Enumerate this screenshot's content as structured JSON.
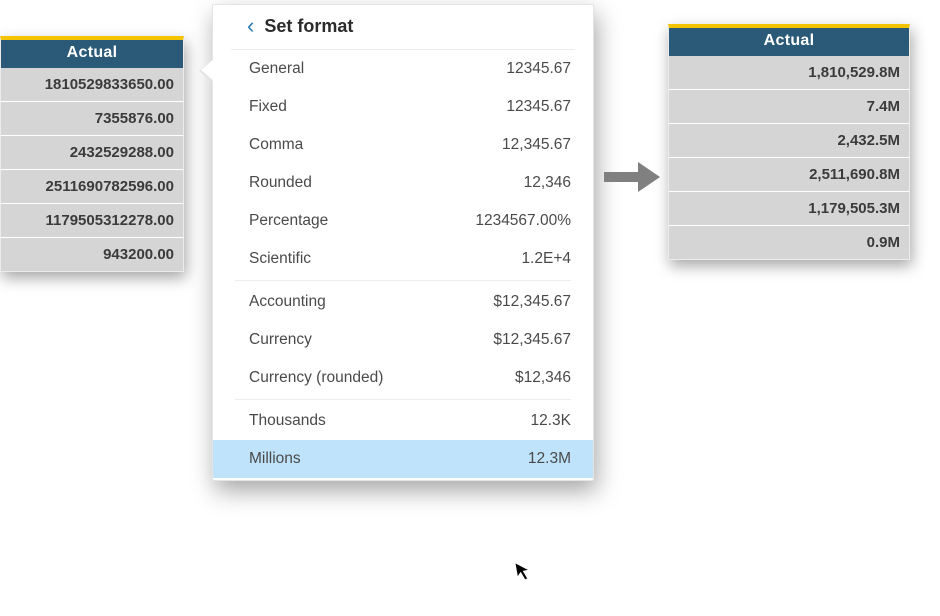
{
  "before": {
    "header": "Actual",
    "rows": [
      "1810529833650.00",
      "7355876.00",
      "2432529288.00",
      "2511690782596.00",
      "1179505312278.00",
      "943200.00"
    ]
  },
  "after": {
    "header": "Actual",
    "rows": [
      "1,810,529.8M",
      "7.4M",
      "2,432.5M",
      "2,511,690.8M",
      "1,179,505.3M",
      "0.9M"
    ]
  },
  "popup": {
    "title": "Set format",
    "back_glyph": "‹",
    "groups": [
      [
        {
          "name": "General",
          "sample": "12345.67",
          "selected": false
        },
        {
          "name": "Fixed",
          "sample": "12345.67",
          "selected": false
        },
        {
          "name": "Comma",
          "sample": "12,345.67",
          "selected": false
        },
        {
          "name": "Rounded",
          "sample": "12,346",
          "selected": false
        },
        {
          "name": "Percentage",
          "sample": "1234567.00%",
          "selected": false
        },
        {
          "name": "Scientific",
          "sample": "1.2E+4",
          "selected": false
        }
      ],
      [
        {
          "name": "Accounting",
          "sample": "$12,345.67",
          "selected": false
        },
        {
          "name": "Currency",
          "sample": "$12,345.67",
          "selected": false
        },
        {
          "name": "Currency (rounded)",
          "sample": "$12,346",
          "selected": false
        }
      ],
      [
        {
          "name": "Thousands",
          "sample": "12.3K",
          "selected": false
        },
        {
          "name": "Millions",
          "sample": "12.3M",
          "selected": true
        }
      ]
    ]
  }
}
